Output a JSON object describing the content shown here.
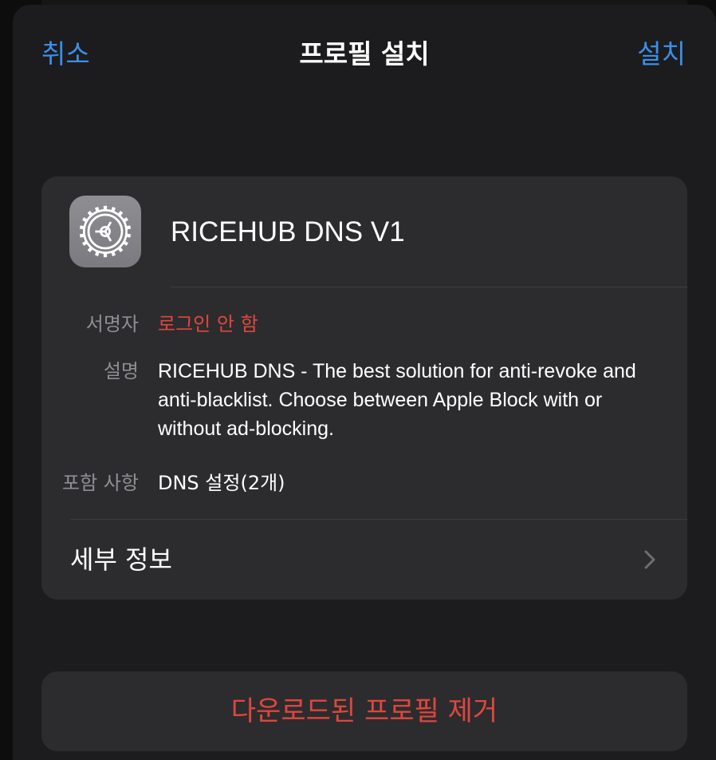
{
  "nav": {
    "cancel_label": "취소",
    "title": "프로필 설치",
    "install_label": "설치"
  },
  "profile": {
    "icon": "settings-gear-icon",
    "name": "RICEHUB DNS V1",
    "signer_label": "서명자",
    "signer_value": "로그인 안 함",
    "description_label": "설명",
    "description_value": "RICEHUB DNS - The best solution for anti-revoke and anti-blacklist. Choose between Apple Block with or without ad-blocking.",
    "contains_label": "포함 사항",
    "contains_value": "DNS 설정(2개)",
    "details_label": "세부 정보"
  },
  "actions": {
    "remove_label": "다운로드된 프로필 제거"
  },
  "colors": {
    "accent": "#3c8fe8",
    "destructive": "#e0463d",
    "card": "#2c2c2e",
    "sheet": "#1c1c1e"
  }
}
